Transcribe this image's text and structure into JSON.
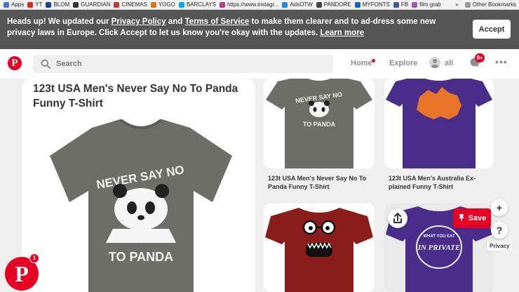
{
  "bookmarks": [
    {
      "label": "Apps",
      "icon": "apps-grid-icon",
      "color": "#4a6ee0"
    },
    {
      "label": "YT",
      "icon": "youtube-icon",
      "color": "#e62117"
    },
    {
      "label": "BLOM",
      "icon": "blom-icon",
      "color": "#1d3f8c"
    },
    {
      "label": "GUARDIAN",
      "icon": "guardian-icon",
      "color": "#333333"
    },
    {
      "label": "CINEMAS",
      "icon": "cinemas-icon",
      "color": "#c0392b"
    },
    {
      "label": "YOGO",
      "icon": "yogo-icon",
      "color": "#d27a1a"
    },
    {
      "label": "BARCLAYS",
      "icon": "barclays-icon",
      "color": "#00aeef"
    },
    {
      "label": "https://www.instagr...",
      "icon": "instagram-icon",
      "color": "#c13584"
    },
    {
      "label": "AdsOTW",
      "icon": "adsotw-icon",
      "color": "#1e88e5"
    },
    {
      "label": "PANDORE",
      "icon": "pandore-icon",
      "color": "#444444"
    },
    {
      "label": "MYFONTS",
      "icon": "myfonts-icon",
      "color": "#1565c0"
    },
    {
      "label": "FB",
      "icon": "facebook-icon",
      "color": "#3b5998"
    },
    {
      "label": "film grab",
      "icon": "film-grab-icon",
      "color": "#9b59b6"
    }
  ],
  "bookmarks_more": "»",
  "bookmarks_other": "Other Bookmarks",
  "banner": {
    "text_1": "Heads up! We updated our ",
    "link_privacy": "Privacy Policy",
    "text_2": " and ",
    "link_terms": "Terms of Service",
    "text_3": " to make them clearer and to ad-dress some new privacy laws in Europe. Click Accept to let us know you're okay with the updates. ",
    "link_learn": "Learn more",
    "accept": "Accept"
  },
  "header": {
    "logo": "P",
    "search_placeholder": "Search",
    "nav_home": "Home",
    "nav_explore": "Explore",
    "user": "ali",
    "notifications": "9+",
    "more": "•••"
  },
  "pin": {
    "title": "123t USA Men's Never Say No To Panda Funny T-Shirt",
    "shirt_text_top": "NEVER SAY NO",
    "shirt_text_bottom": "TO PANDA",
    "shirt_color": "#6e6e69"
  },
  "grid": [
    {
      "caption": "123t USA Men's Never Say No To Panda Funny T-Shirt",
      "shirt_color": "#6e6e69",
      "text_top": "NEVER SAY NO",
      "text_bottom": "TO PANDA"
    },
    {
      "caption": "123t USA Men's Australia Ex-plained Funny T-Shirt",
      "shirt_color": "#4a2c8a"
    },
    {
      "shirt_color": "#8c1d1d"
    },
    {
      "shirt_color": "#4a2c8a",
      "text_top": "WHAT YOU EAT",
      "text_bottom": "IN PRIVATE"
    }
  ],
  "actions": {
    "save": "Save",
    "add": "+",
    "help": "?",
    "privacy": "Privacy"
  },
  "fab": {
    "logo": "P",
    "badge": "1"
  },
  "colors": {
    "brand": "#e60023",
    "banner_bg": "#555555"
  }
}
